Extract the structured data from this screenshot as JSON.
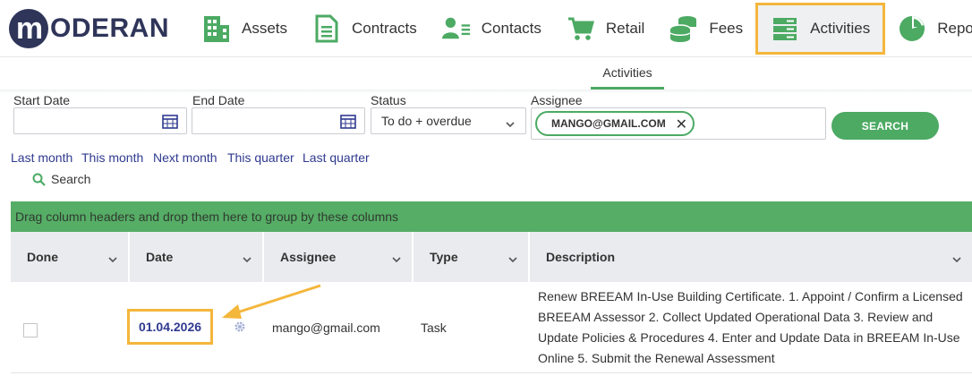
{
  "brand": {
    "logo_mark": "m",
    "logo_text": "ODERAN"
  },
  "nav": {
    "items": [
      {
        "label": "Assets",
        "icon": "building-icon"
      },
      {
        "label": "Contracts",
        "icon": "document-icon"
      },
      {
        "label": "Contacts",
        "icon": "contact-card-icon"
      },
      {
        "label": "Retail",
        "icon": "shopping-cart-icon"
      },
      {
        "label": "Fees",
        "icon": "coins-icon"
      },
      {
        "label": "Activities",
        "icon": "activities-list-icon",
        "active": true
      },
      {
        "label": "Reports",
        "icon": "pie-chart-icon"
      }
    ]
  },
  "subnav": {
    "active_tab": "Activities"
  },
  "filters": {
    "start_date": {
      "label": "Start Date",
      "value": ""
    },
    "end_date": {
      "label": "End Date",
      "value": ""
    },
    "status": {
      "label": "Status",
      "value": "To do + overdue"
    },
    "assignee": {
      "label": "Assignee",
      "chip": "MANGO@GMAIL.COM",
      "chip_remove": "✕"
    },
    "search_button": "SEARCH"
  },
  "quick_ranges": [
    "Last month",
    "This month",
    "Next month",
    "This quarter",
    "Last quarter"
  ],
  "search_link": "Search",
  "grid": {
    "group_hint": "Drag column headers and drop them here to group by these columns",
    "columns": [
      "Done",
      "Date",
      "Assignee",
      "Type",
      "Description"
    ],
    "rows": [
      {
        "done": false,
        "date": "01.04.2026",
        "assignee": "mango@gmail.com",
        "type": "Task",
        "description": "Renew BREEAM In-Use Building Certificate. 1. Appoint / Confirm a Licensed BREEAM Assessor 2. Collect Updated Operational Data 3. Review and Update Policies & Procedures 4. Enter and Update Data in BREEAM In-Use Online 5. Submit the Renewal Assessment"
      }
    ]
  },
  "colors": {
    "accent_green": "#4caa63",
    "highlight_orange": "#f4b63b",
    "brand_navy": "#2f3559",
    "link_blue": "#2f3a8f"
  }
}
